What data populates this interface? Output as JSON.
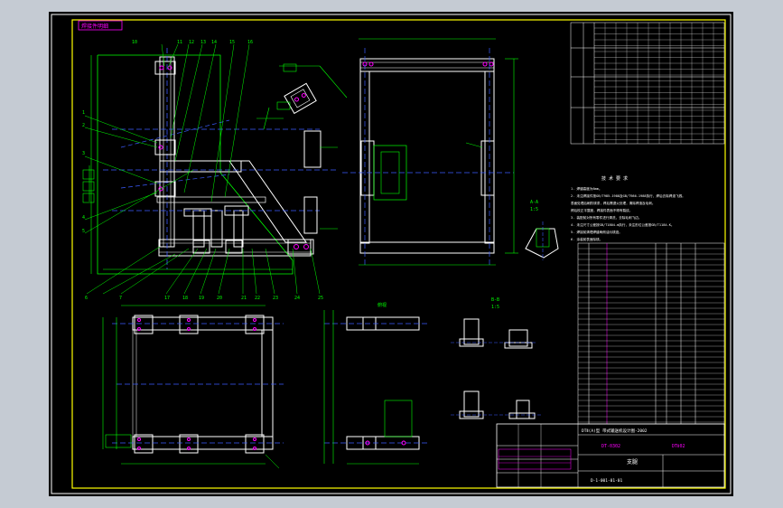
{
  "drawing": {
    "corner_tag": "焊接件明细",
    "view_labels": {
      "section_a": "A-A",
      "section_b": "B-B",
      "scale_a": "1:5",
      "scale_b": "1:5",
      "top_view": "俯视"
    },
    "notes_title": "技 术 要 求",
    "notes": [
      "1. 焊缝高度为6mm。",
      "2. 未注焊接件按GB/T985-1988及GB/T986-1988执行，焊后去除焊渣飞溅。",
      "   表面处理后刷防锈漆，焊后需退火处理，清除焊渣及毛刺。",
      "   焊后校正平整度，焊接件表面不得有裂纹。",
      "3. 装配前对所有零件进行清洗，去除毛刺飞边。",
      "4. 未注尺寸公差按GB/T1804-m执行，未注形位公差按GB/T1184-K。",
      "5. 焊接前清理焊缝两侧油污锈迹。",
      "6. 涂装前表面除锈。"
    ],
    "title_block": {
      "project": "DTⅡ(A)型 带式输送机设计图-2002",
      "drawing_no": "DT-0302",
      "part_name": "支腿",
      "code": "DTⅡ02",
      "footer_no": "D-1-001-01-01"
    },
    "balloons": [
      "1",
      "2",
      "3",
      "4",
      "5",
      "6",
      "7",
      "8",
      "9",
      "10",
      "11",
      "12",
      "13",
      "14",
      "15",
      "16",
      "17",
      "18",
      "19",
      "20",
      "21",
      "22",
      "23",
      "24",
      "25",
      "26",
      "27",
      "28",
      "29",
      "30"
    ]
  }
}
